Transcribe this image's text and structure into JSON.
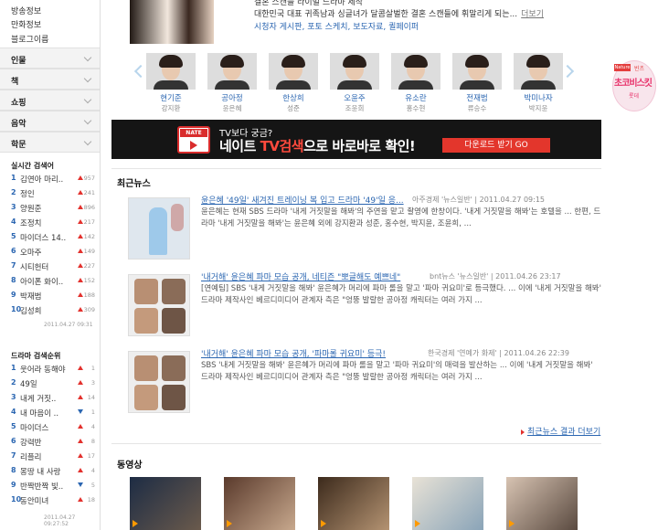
{
  "sidebar": {
    "links": [
      "방송정보",
      "만화정보",
      "블로그이름"
    ],
    "categories": [
      "인물",
      "책",
      "쇼핑",
      "음악",
      "학문"
    ],
    "realtime": {
      "title": "실시간 검색어",
      "items": [
        {
          "rank": "1",
          "text": "김연아 마리..",
          "dir": "up",
          "count": "957"
        },
        {
          "rank": "2",
          "text": "정인",
          "dir": "up",
          "count": "241"
        },
        {
          "rank": "3",
          "text": "양원준",
          "dir": "up",
          "count": "896"
        },
        {
          "rank": "4",
          "text": "조정치",
          "dir": "up",
          "count": "217"
        },
        {
          "rank": "5",
          "text": "마이더스 14..",
          "dir": "up",
          "count": "142"
        },
        {
          "rank": "6",
          "text": "오마주",
          "dir": "up",
          "count": "149"
        },
        {
          "rank": "7",
          "text": "시티헌터",
          "dir": "up",
          "count": "227"
        },
        {
          "rank": "8",
          "text": "아이폰 화이..",
          "dir": "up",
          "count": "152"
        },
        {
          "rank": "9",
          "text": "박재범",
          "dir": "up",
          "count": "188"
        },
        {
          "rank": "10",
          "text": "김성희",
          "dir": "up",
          "count": "309"
        }
      ],
      "date": "2011.04.27 09:31"
    },
    "drama": {
      "title": "드라마 검색순위",
      "items": [
        {
          "rank": "1",
          "text": "웃어라 동해야",
          "dir": "up",
          "count": "1"
        },
        {
          "rank": "2",
          "text": "49일",
          "dir": "up",
          "count": "3"
        },
        {
          "rank": "3",
          "text": "내게 거짓..",
          "dir": "up",
          "count": "14"
        },
        {
          "rank": "4",
          "text": "내 마음이 ..",
          "dir": "down",
          "count": "1"
        },
        {
          "rank": "5",
          "text": "마이더스",
          "dir": "up",
          "count": "4"
        },
        {
          "rank": "6",
          "text": "강력반",
          "dir": "up",
          "count": "8"
        },
        {
          "rank": "7",
          "text": "리플리",
          "dir": "up",
          "count": "17"
        },
        {
          "rank": "8",
          "text": "몽땅 내 사랑",
          "dir": "up",
          "count": "4"
        },
        {
          "rank": "9",
          "text": "반짝반짝 빛..",
          "dir": "down",
          "count": "5"
        },
        {
          "rank": "10",
          "text": "동안미녀",
          "dir": "up",
          "count": "18"
        }
      ],
      "date": "2011.04.27 09:27:52"
    }
  },
  "top": {
    "cut_line": "결혼 스캔들 라이벌 드라마 제작",
    "desc": "대한민국 대표 귀족남과 싱글녀가 달콤살벌한 결혼 스캔들에 휘말리게 되는...",
    "more": "더보기",
    "links": "시청자 게시판, 포토 스케치, 보도자료, 퀼페이퍼"
  },
  "cast": [
    {
      "name": "현기준",
      "role": "강지환"
    },
    {
      "name": "공아정",
      "role": "윤은혜"
    },
    {
      "name": "한상희",
      "role": "성준"
    },
    {
      "name": "오윤주",
      "role": "조윤희"
    },
    {
      "name": "유소란",
      "role": "홍수현"
    },
    {
      "name": "전재범",
      "role": "류승수"
    },
    {
      "name": "박미나자",
      "role": "박지윤"
    }
  ],
  "banner": {
    "small": "TV보다 궁금?",
    "big_prefix": "네이트 ",
    "big_highlight": "TV검색",
    "big_suffix": "으로 바로바로 확인!",
    "icon_label": "NATE",
    "button": "다운로드 받기 GO"
  },
  "news": {
    "title": "최근뉴스",
    "items": [
      {
        "title": "윤은혜 '49일' 새겨진 트레이닝 복 입고 드라마 '49'일 응...",
        "source": "아주경제 '뉴스일반'",
        "date": "2011.04.27 09:15",
        "body": "윤은혜는 현재 SBS 드라마 '내게 거짓말을 해봐'의 주연을 맡고 촬영에 한창이다. '내게 거짓말을 해봐'는 호텔을 ... 한편, 드라마 '내게 거짓말을 해봐'는 윤은혜 외에 강지환과 성준, 홍수현, 박지윤, 조윤희, ..."
      },
      {
        "title": "'내거해' 윤은혜 파마 모습 공개, 네티즌 \"뽀글해도 예쁘네\"",
        "source": "bnt뉴스 '뉴스일반'",
        "date": "2011.04.26 23:17",
        "body": "[연예팀] SBS '내게 거짓말을 해봐' 윤은혜가 머리에 파마 롤을 말고 '파마 귀요미'로 등극했다. ... 이에 '내게 거짓말을 해봐' 드라마 제작사인 베르디미디어 관계자 측은 \"엉뚱 발랄한 공아정 캐릭터는 여러 가지 ..."
      },
      {
        "title": "'내거해' 윤은혜 파마 모습 공개, '파마롤 귀요미' 등극!",
        "source": "한국경제 '연예가 화제'",
        "date": "2011.04.26 22:39",
        "body": "SBS '내게 거짓말을 해봐' 윤은혜가 머리에 파마 롤을 말고 '파마 귀요미'의 매력을 발산하는 ... 이에 '내게 거짓말을 해봐' 드라마 제작사인 베르디미디어 관계자 측은 \"엉뚱 발랄한 공아정 캐릭터는 여러 가지 ..."
      }
    ],
    "more": "최근뉴스 결과 더보기"
  },
  "video": {
    "title": "동영상"
  },
  "ad": {
    "tag": "Nature",
    "small": "빈츠",
    "big": "초코비스킷",
    "brand": "롯데"
  }
}
